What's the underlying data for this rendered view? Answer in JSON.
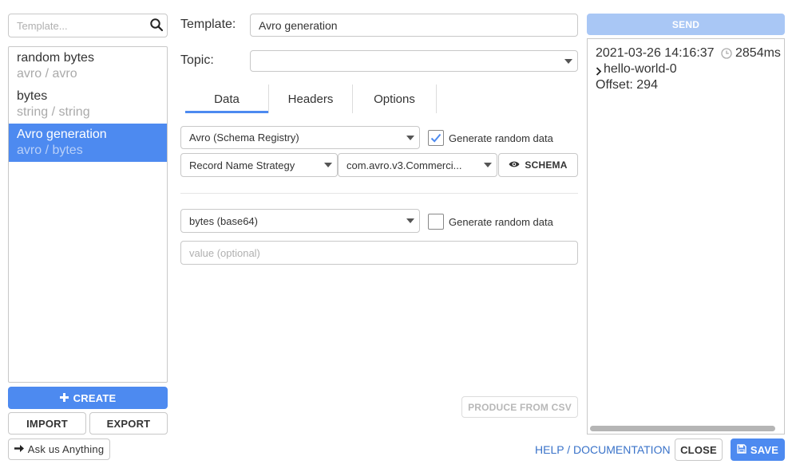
{
  "sidebar": {
    "search_placeholder": "Template...",
    "items": [
      {
        "title": "random bytes",
        "subtitle": "avro / avro",
        "active": false
      },
      {
        "title": "bytes",
        "subtitle": "string / string",
        "active": false
      },
      {
        "title": "Avro generation",
        "subtitle": "avro / bytes",
        "active": true
      }
    ],
    "create_label": "CREATE",
    "import_label": "IMPORT",
    "export_label": "EXPORT",
    "ask_label": "Ask us Anything"
  },
  "form": {
    "template_label": "Template:",
    "template_value": "Avro generation",
    "topic_label": "Topic:",
    "topic_value": "",
    "tabs": [
      {
        "label": "Data",
        "active": true
      },
      {
        "label": "Headers",
        "active": false
      },
      {
        "label": "Options",
        "active": false
      }
    ],
    "key_serializer": "Avro (Schema Registry)",
    "key_generate_label": "Generate random data",
    "key_generate_checked": true,
    "strategy": "Record Name Strategy",
    "subject": "com.avro.v3.Commerci...",
    "schema_label": "SCHEMA",
    "value_serializer": "bytes (base64)",
    "value_generate_label": "Generate random data",
    "value_generate_checked": false,
    "value_placeholder": "value (optional)",
    "produce_csv_label": "PRODUCE FROM CSV"
  },
  "result": {
    "send_label": "SEND",
    "timestamp": "2021-03-26 14:16:37",
    "duration": "2854ms",
    "partition": "hello-world-0",
    "offset": "Offset: 294"
  },
  "footer": {
    "help_label": "HELP / DOCUMENTATION",
    "close_label": "CLOSE",
    "save_label": "SAVE"
  },
  "colors": {
    "accent": "#4d8af0",
    "accent_disabled": "#a9c7f5",
    "link": "#3a73c9"
  }
}
